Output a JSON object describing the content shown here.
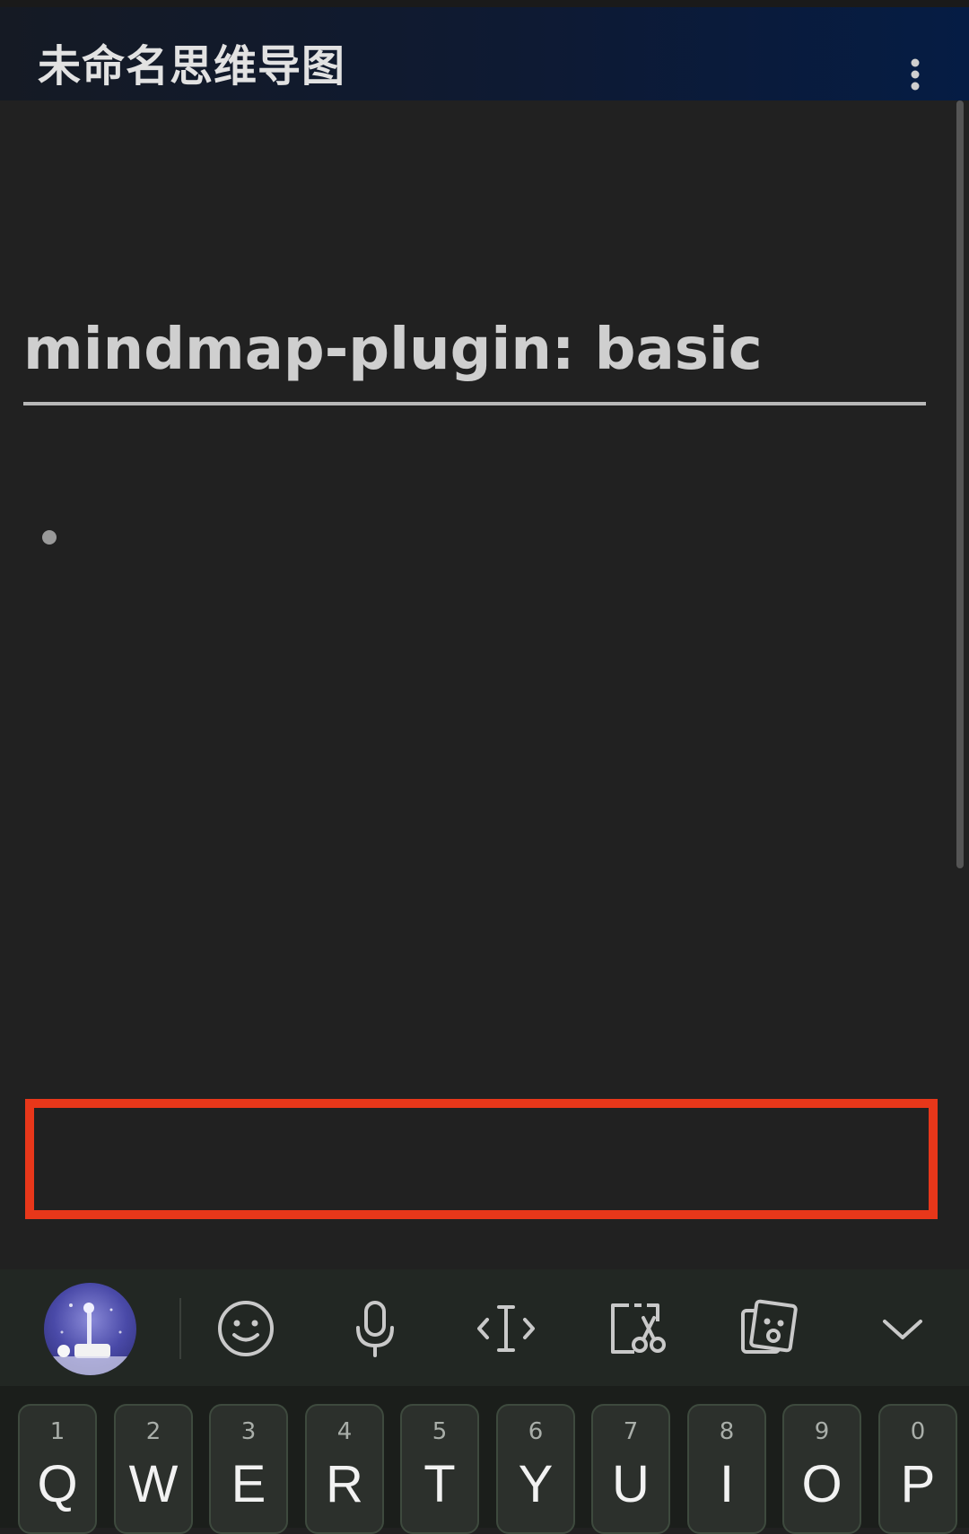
{
  "app_bar": {
    "title": "未命名思维导图",
    "menu_icon": "more-vert-icon"
  },
  "note": {
    "title": "mindmap-plugin: basic",
    "bullet_text": ""
  },
  "input_box": {
    "value": ""
  },
  "keyboard_toolbar": {
    "items": [
      {
        "name": "avatar"
      },
      {
        "icon": "emoji-icon"
      },
      {
        "icon": "microphone-icon"
      },
      {
        "icon": "cursor-icon"
      },
      {
        "icon": "clipboard-icon"
      },
      {
        "icon": "sticker-icon"
      },
      {
        "icon": "chevron-down-icon"
      }
    ]
  },
  "keyboard": {
    "row1": [
      {
        "num": "1",
        "letter": "Q"
      },
      {
        "num": "2",
        "letter": "W"
      },
      {
        "num": "3",
        "letter": "E"
      },
      {
        "num": "4",
        "letter": "R"
      },
      {
        "num": "5",
        "letter": "T"
      },
      {
        "num": "6",
        "letter": "Y"
      },
      {
        "num": "7",
        "letter": "U"
      },
      {
        "num": "8",
        "letter": "I"
      },
      {
        "num": "9",
        "letter": "O"
      },
      {
        "num": "0",
        "letter": "P"
      }
    ]
  },
  "colors": {
    "background": "#212121",
    "appbar_start": "#151a24",
    "appbar_end": "#051c44",
    "highlight_border": "#e8371a"
  }
}
